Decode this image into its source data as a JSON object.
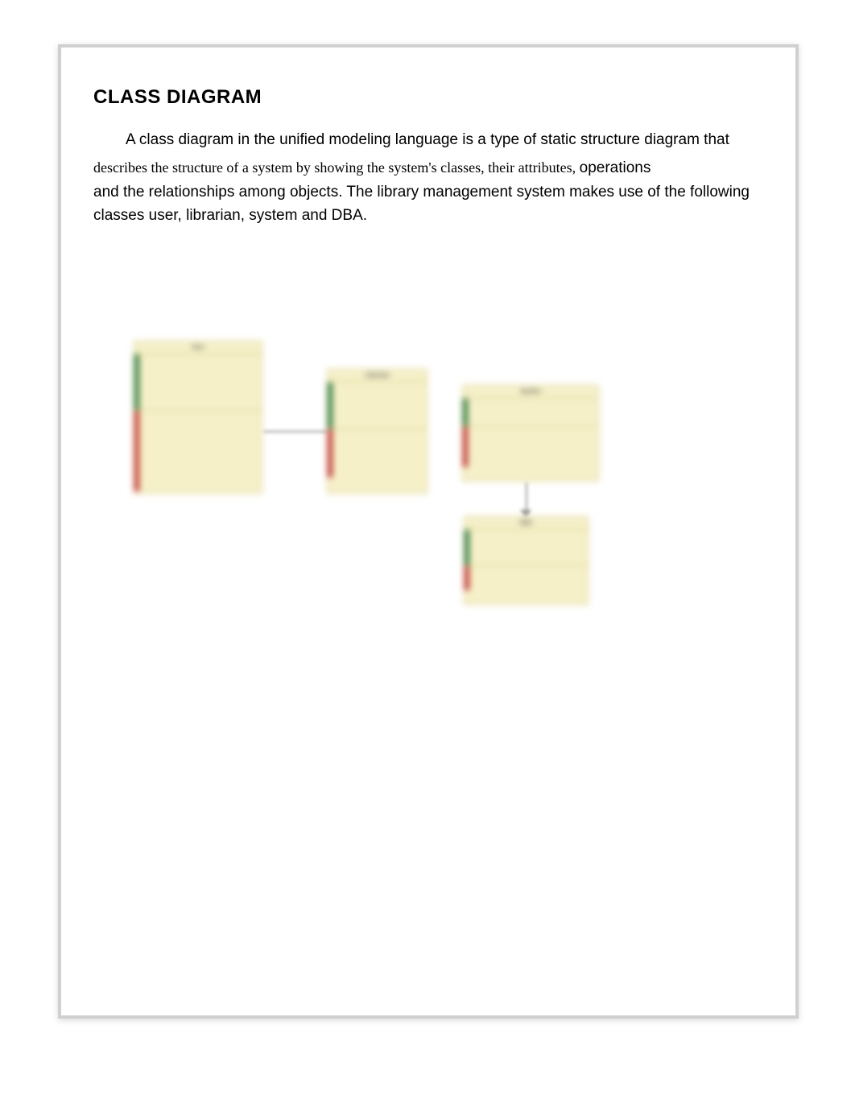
{
  "document": {
    "heading": "CLASS DIAGRAM",
    "paragraph_line1": "A class diagram in the unified modeling language is a type of static structure diagram that",
    "paragraph_line2": "describes the structure of a system by showing the system's classes, their attributes, ",
    "paragraph_line2b": "operations",
    "paragraph_line3": "and the relationships among objects. The library management system makes use of the following",
    "paragraph_line4": "classes user, librarian, system and DBA."
  },
  "diagram": {
    "classes": {
      "user": {
        "title": "User"
      },
      "librarian": {
        "title": "Librarian"
      },
      "system": {
        "title": "System"
      },
      "dba": {
        "title": "DBA"
      }
    }
  }
}
